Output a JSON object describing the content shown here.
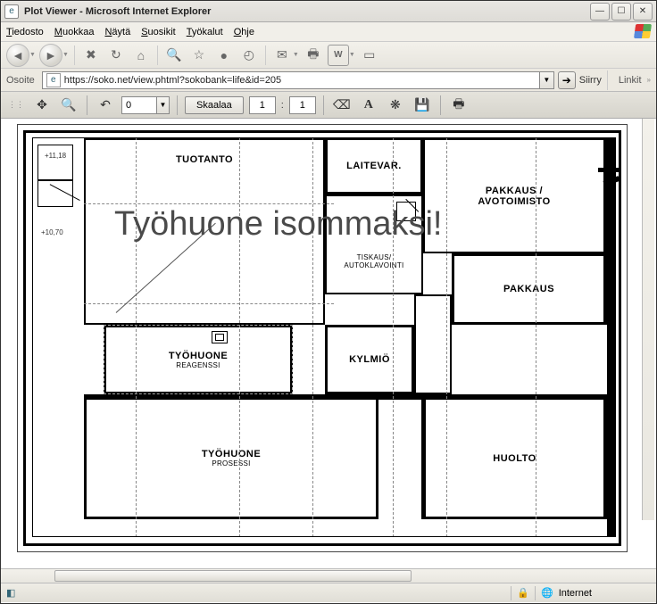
{
  "window": {
    "title": "Plot Viewer - Microsoft Internet Explorer"
  },
  "menu": {
    "tiedosto": "Tiedosto",
    "muokkaa": "Muokkaa",
    "nayta": "Näytä",
    "suosikit": "Suosikit",
    "tyokalut": "Työkalut",
    "ohje": "Ohje"
  },
  "address": {
    "label": "Osoite",
    "url": "https://soko.net/view.phtml?sokobank=life&id=205",
    "go_label": "Siirry",
    "linkit": "Linkit"
  },
  "apptoolbar": {
    "zoom_value": "0",
    "scale_label": "Skaalaa",
    "scale_a": "1",
    "scale_sep": ":",
    "scale_b": "1"
  },
  "plan": {
    "overlay_text": "Työhuone isommaksi!",
    "dims": {
      "top": "+11,18",
      "side": "+10,70"
    },
    "rooms": {
      "tuotanto": "TUOTANTO",
      "laitevar": "LAITEVAR.",
      "pakkaus_avo": "PAKKAUS /\nAVOTOIMISTO",
      "tiskaus": "TISKAUS/\nAUTOKLAVOINTI",
      "pakkaus": "PAKKAUS",
      "tyohuone_reag": "TYÖHUONE",
      "tyohuone_reag_sub": "REAGENSSI",
      "kylmio": "KYLMIÖ",
      "tyohuone_pros": "TYÖHUONE",
      "tyohuone_pros_sub": "PROSESSI",
      "huolto": "HUOLTO"
    }
  },
  "status": {
    "zone": "Internet"
  }
}
